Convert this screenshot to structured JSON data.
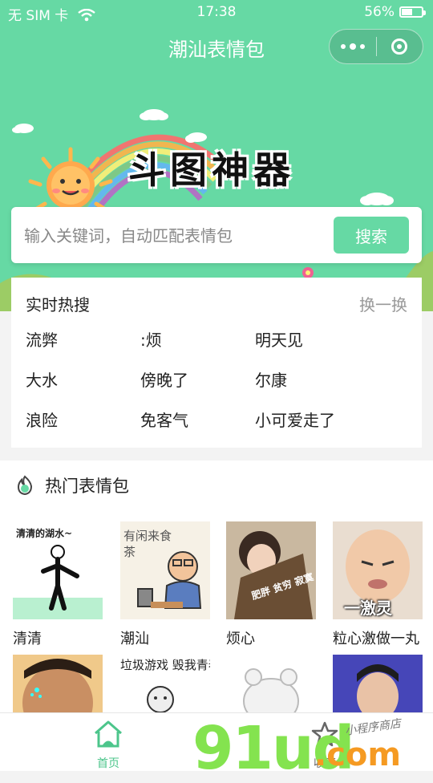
{
  "status_bar": {
    "carrier": "无 SIM 卡",
    "time": "17:38",
    "battery_percent": "56%",
    "battery_level": 0.56
  },
  "nav_bar": {
    "title": "潮汕表情包"
  },
  "hero": {
    "banner_title": "斗图神器"
  },
  "search": {
    "placeholder": "输入关键词，自动匹配表情包",
    "button_label": "搜索"
  },
  "hot_search": {
    "title": "实时热搜",
    "refresh_label": "换一换",
    "keywords": [
      "流弊",
      ":烦",
      "明天见",
      "大水",
      "傍晚了",
      "尔康",
      "浪险",
      "免客气",
      "小可爱走了"
    ]
  },
  "popular": {
    "title": "热门表情包",
    "items": [
      {
        "caption": "清清",
        "image_text": "清清的湖水~"
      },
      {
        "caption": "潮汕",
        "image_text": "有闲来食茶"
      },
      {
        "caption": "烦心",
        "image_text": "肥胖 贫穷 寂寞"
      },
      {
        "caption": "粒心激做一丸",
        "image_text": "一激灵"
      },
      {
        "caption": "",
        "image_text": ""
      },
      {
        "caption": "",
        "image_text": "垃圾游戏 毁我青春"
      },
      {
        "caption": "",
        "image_text": ""
      },
      {
        "caption": "",
        "image_text": ""
      }
    ]
  },
  "tab_bar": {
    "tabs": [
      {
        "label": "首页",
        "active": true,
        "color": "#4cc58b"
      },
      {
        "label": "收藏",
        "active": false,
        "color": "#666666"
      }
    ]
  },
  "watermark": {
    "text": "91ud",
    "suffix": ".com",
    "sub": "小程序商店"
  },
  "colors": {
    "accent": "#66d9a4",
    "background": "#f3f3f3"
  }
}
